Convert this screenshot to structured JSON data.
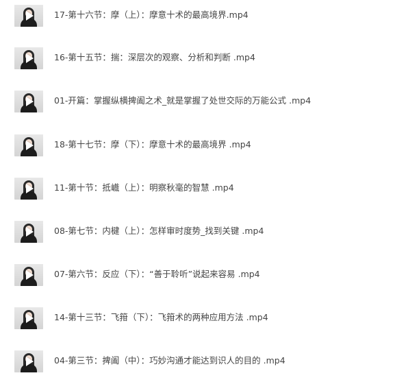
{
  "files": [
    {
      "name": "17-第十六节：摩（上）：摩意十术的最高境界.mp4"
    },
    {
      "name": "16-第十五节：揣：深层次的观察、分析和判断 .mp4"
    },
    {
      "name": "01-开篇：掌握纵横捭阖之术_就是掌握了处世交际的万能公式 .mp4"
    },
    {
      "name": "18-第十七节：摩（下）：摩意十术的最高境界 .mp4"
    },
    {
      "name": "11-第十节：抵巇（上）：明察秋毫的智慧 .mp4"
    },
    {
      "name": "08-第七节：内楗（上）：怎样审时度势_找到关键 .mp4"
    },
    {
      "name": "07-第六节：反应（下）：“善于聆听”说起来容易 .mp4"
    },
    {
      "name": "14-第十三节：飞箝（下）：飞箝术的两种应用方法 .mp4"
    },
    {
      "name": "04-第三节：捭阖（中）：巧妙沟通才能达到识人的目的 .mp4"
    }
  ],
  "icons": {
    "thumbnail": "video-thumbnail-icon",
    "play": "play-icon"
  }
}
